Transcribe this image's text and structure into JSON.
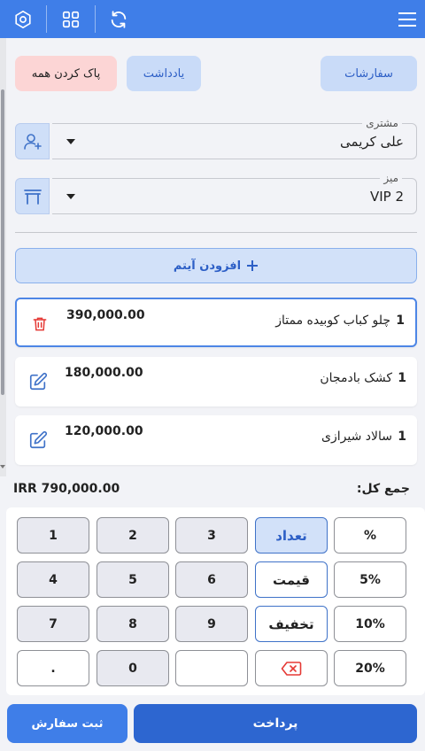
{
  "actions": {
    "orders_label": "سفارشات",
    "note_label": "یادداشت",
    "clear_all_label": "پاک کردن همه"
  },
  "customer": {
    "label": "مشتری",
    "value": "علی کریمی",
    "icon": "add-user-icon"
  },
  "table": {
    "label": "میز",
    "value": "VIP 2",
    "icon": "table-icon"
  },
  "add_item_label": "افزودن آیتم",
  "items": [
    {
      "qty": "1",
      "name": "چلو کباب کوبیده ممتاز",
      "price": "390,000.00",
      "icon": "trash-icon"
    },
    {
      "qty": "1",
      "name": "کشک بادمجان",
      "price": "180,000.00",
      "icon": "edit-icon"
    },
    {
      "qty": "1",
      "name": "سالاد شیرازی",
      "price": "120,000.00",
      "icon": "edit-icon"
    }
  ],
  "total": {
    "label": "جمع کل:",
    "value": "IRR 790,000.00"
  },
  "keypad": {
    "row1": [
      "%",
      "تعداد",
      "3",
      "2",
      "1"
    ],
    "row2": [
      "5%",
      "قیمت",
      "6",
      "5",
      "4"
    ],
    "row3": [
      "10%",
      "تخفیف",
      "9",
      "8",
      "7"
    ],
    "row4": [
      "20%",
      "",
      "",
      "0",
      "."
    ],
    "selected_mode": "تعداد"
  },
  "buttons": {
    "pay_label": "پرداخت",
    "submit_order_label": "ثبت سفارش"
  },
  "colors": {
    "primary": "#3f7ee8",
    "danger": "#e53935",
    "light_blue": "#d2e1f9"
  }
}
